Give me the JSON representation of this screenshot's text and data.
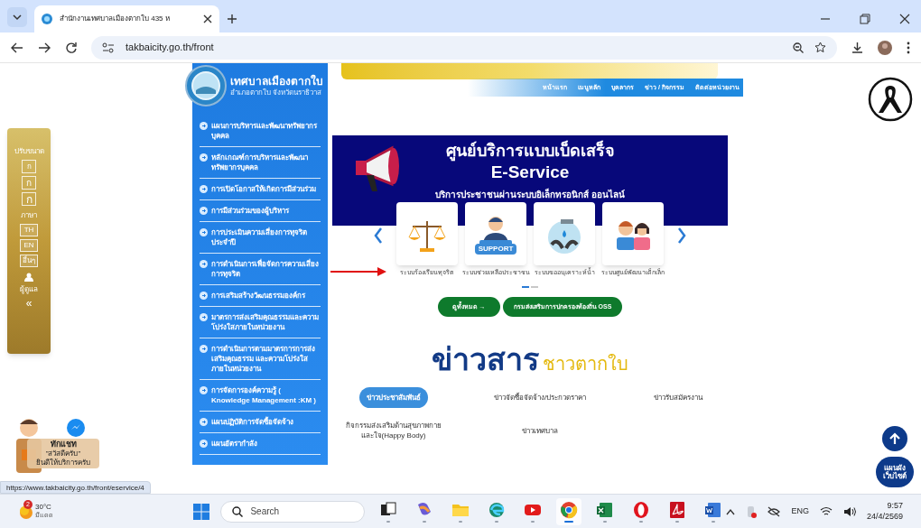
{
  "browser": {
    "tab_title": "สำนักงานเทศบาลเมืองตากใบ 435 ห",
    "url": "takbaicity.go.th/front",
    "status_url": "https://www.takbaicity.go.th/front/eservice/4"
  },
  "logo": {
    "title": "เทศบาลเมืองตากใบ",
    "subtitle": "อำเภอตากใบ จังหวัดนราธิวาส"
  },
  "sidebar": [
    {
      "label": "แผนการบริหารและพัฒนาทรัพยากรบุคคล"
    },
    {
      "label": "หลักเกณฑ์การบริหารและพัฒนาทรัพยากรบุคคล"
    },
    {
      "label": "การเปิดโอกาสให้เกิดการมีส่วนร่วม"
    },
    {
      "label": "การมีส่วนร่วมของผู้บริหาร"
    },
    {
      "label": "การประเมินความเสี่ยงการทุจริตประจำปี"
    },
    {
      "label": "การดำเนินการเพื่อจัดการความเสี่ยงการทุจริต"
    },
    {
      "label": "การเสริมสร้างวัฒนธรรมองค์กร"
    },
    {
      "label": "มาตรการส่งเสริมคุณธรรมและความโปร่งใสภายในหน่วยงาน"
    },
    {
      "label": "การดำเนินการตามมาตรการการส่งเสริมคุณธรรม และความโปร่งใสภายในหน่วยงาน"
    },
    {
      "label": "การจัดการองค์ความรู้ ( Knowledge Management :KM )"
    },
    {
      "label": "แผนปฏิบัติการจัดซื้อจัดจ้าง"
    },
    {
      "label": "แผนอัตรากำลัง"
    }
  ],
  "nav": [
    "หน้าแรก",
    "เมนูหลัก",
    "บุคลากร",
    "ข่าว / กิจกรรม",
    "ติดต่อหน่วยงาน"
  ],
  "banner": {
    "title": "ศูนย์บริการแบบเบ็ดเสร็จ",
    "subtitle": "E-Service",
    "tagline": "บริการประชาชนผ่านระบบอิเล็กทรอนิกส์ ออนไลน์"
  },
  "services": [
    {
      "kind": "scales",
      "label": "ระบบร้องเรียนทุจริต"
    },
    {
      "kind": "support",
      "label": "ระบบช่วยเหลือประชาชน",
      "badge": "SUPPORT"
    },
    {
      "kind": "water",
      "label": "ระบบขออนุเคราะห์น้ำ"
    },
    {
      "kind": "children",
      "label": "ระบบศูนย์พัฒนาเด็กเล็ก"
    }
  ],
  "carousel_dots": [
    {
      "selected": true
    },
    {
      "selected": false
    }
  ],
  "buttons": [
    "ดูทั้งหมด →",
    "กรมส่งเสริมการปกครองท้องถิ่น OSS"
  ],
  "news_heading": {
    "main": "ข่าวสาร",
    "accent": "ชาวตากใบ"
  },
  "news_tabs": [
    {
      "label": "ข่าวประชาสัมพันธ์",
      "selected": true
    },
    {
      "label": "ข่าวจัดซื้อจัดจ้าง/ประกวดราคา",
      "selected": false
    },
    {
      "label": "ข่าวรับสมัครงาน",
      "selected": false
    },
    {
      "label": "กิจกรรมส่งเสริมด้านสุขภาพกายและใจ(Happy Body)",
      "selected": false
    },
    {
      "label": "ข่าวเทศบาล",
      "selected": false
    }
  ],
  "accessibility": {
    "size_label": "ปรับขนาด",
    "size_buttons": [
      "ก",
      "ก",
      "ก"
    ],
    "lang_label": "ภาษา",
    "lang_buttons": [
      "TH",
      "EN",
      "อื่นๆ"
    ],
    "user_label": "ผู้ดูแล",
    "collapse": "«"
  },
  "chat_widget": {
    "title": "ทักแชท",
    "greeting": "\"สวัสดีครับ\"",
    "note": "ยินดีให้บริการครับ"
  },
  "sitemap_button": "แผนผังเว็บไซต์",
  "taskbar": {
    "weather_badge": "2",
    "temperature": "30°C",
    "weather": "มีแดด",
    "search": "Search",
    "language": "ENG",
    "time": "9:57",
    "date": "24/4/2569",
    "apps": [
      {
        "kind": "taskview",
        "selected": false
      },
      {
        "kind": "copilot",
        "selected": false
      },
      {
        "kind": "files",
        "selected": false
      },
      {
        "kind": "edge",
        "selected": false
      },
      {
        "kind": "youtube",
        "selected": false
      },
      {
        "kind": "chrome",
        "selected": true
      },
      {
        "kind": "excel",
        "selected": false
      },
      {
        "kind": "opera",
        "selected": false
      },
      {
        "kind": "pdf",
        "selected": false
      },
      {
        "kind": "word",
        "selected": false
      }
    ]
  }
}
